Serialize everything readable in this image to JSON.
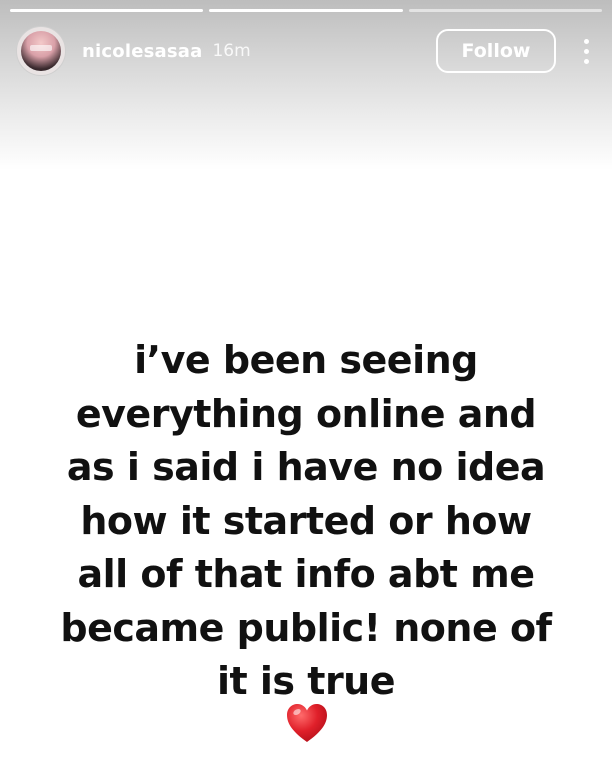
{
  "story": {
    "progress": [
      1,
      1,
      0
    ],
    "user": {
      "username": "nicolesasaa",
      "time": "16m",
      "avatar_icon": "profile-avatar"
    },
    "follow_label": "Follow",
    "more_icon": "more-vertical-icon",
    "text": "i’ve been seeing\neverything online and\nas i said i have no idea\nhow it started or how\nall of that info abt me\nbecame public! none of\nit is true",
    "emoji": "red-heart-icon"
  },
  "colors": {
    "text": "#111111",
    "heart": "#e0202a",
    "overlay_text": "#ffffff"
  }
}
